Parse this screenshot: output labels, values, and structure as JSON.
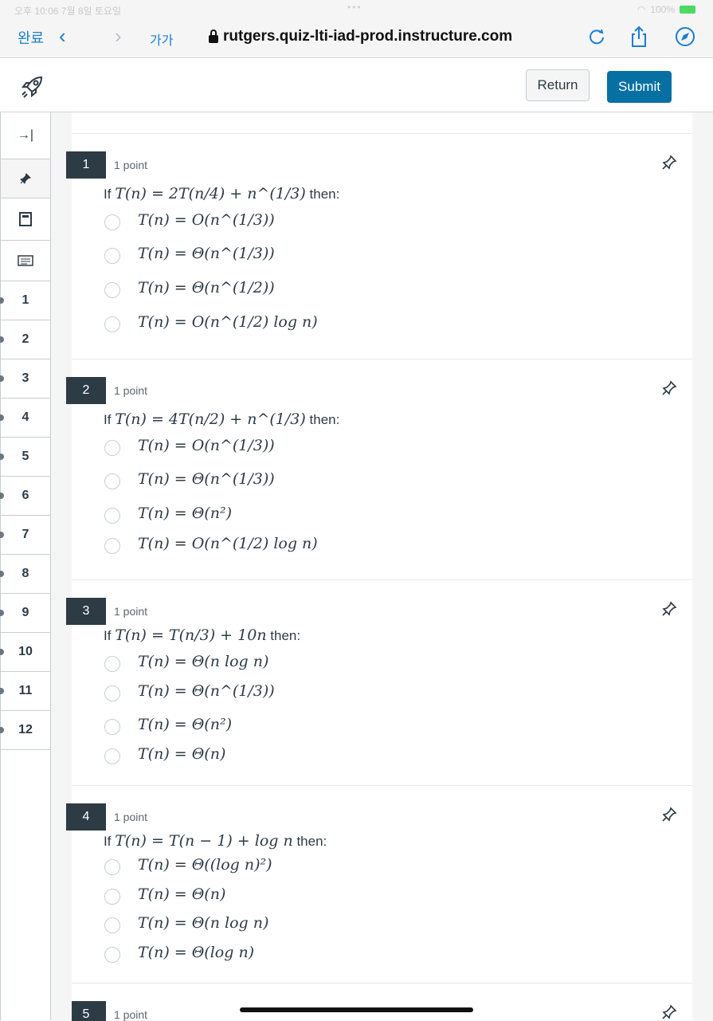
{
  "status": {
    "time": "오후 10:06",
    "date": "7월 8일 토요일",
    "battery": "100%"
  },
  "safari": {
    "done": "완료",
    "font_size": "가가",
    "url": "rutgers.quiz-lti-iad-prod.instructure.com"
  },
  "header": {
    "return_label": "Return",
    "submit_label": "Submit"
  },
  "sidebar": {
    "numbers": [
      "1",
      "2",
      "3",
      "4",
      "5",
      "6",
      "7",
      "8",
      "9",
      "10",
      "11",
      "12"
    ]
  },
  "questions": [
    {
      "number": "1",
      "points": "1 point",
      "prefix": "If",
      "equation": "T(n) = 2T(n/4) + n^(1/3)",
      "suffix": "then:",
      "options": [
        "T(n) = O(n^(1/3))",
        "T(n) = Θ(n^(1/3))",
        "T(n) = Θ(n^(1/2))",
        "T(n) = O(n^(1/2) log n)"
      ]
    },
    {
      "number": "2",
      "points": "1 point",
      "prefix": "If",
      "equation": "T(n) = 4T(n/2) + n^(1/3)",
      "suffix": "then:",
      "options": [
        "T(n) = O(n^(1/3))",
        "T(n) = Θ(n^(1/3))",
        "T(n) = Θ(n²)",
        "T(n) = O(n^(1/2) log n)"
      ]
    },
    {
      "number": "3",
      "points": "1 point",
      "prefix": "If",
      "equation": "T(n) = T(n/3) + 10n",
      "suffix": "then:",
      "options": [
        "T(n) = Θ(n log n)",
        "T(n) = Θ(n^(1/3))",
        "T(n) = Θ(n²)",
        "T(n) = Θ(n)"
      ]
    },
    {
      "number": "4",
      "points": "1 point",
      "prefix": "If",
      "equation": "T(n) = T(n − 1) + log n",
      "suffix": "then:",
      "options": [
        "T(n) = Θ((log n)²)",
        "T(n) = Θ(n)",
        "T(n) = Θ(n log n)",
        "T(n) = Θ(log n)"
      ]
    },
    {
      "number": "5",
      "points": "1 point"
    }
  ]
}
